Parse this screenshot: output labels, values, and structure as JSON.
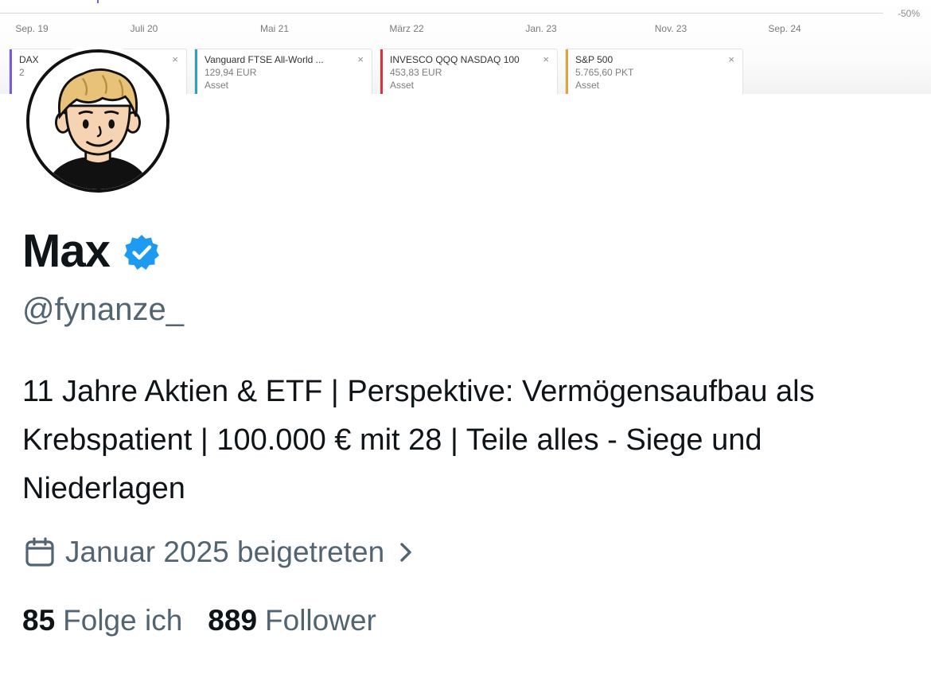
{
  "banner": {
    "pct_label": "-50%",
    "x_ticks": [
      "Sep. 19",
      "Juli 20",
      "Mai 21",
      "März 22",
      "Jan. 23",
      "Nov. 23",
      "Sep. 24"
    ],
    "assets": [
      {
        "name": "DAX",
        "value": "2",
        "type": "",
        "color": "#7b5cd6"
      },
      {
        "name": "Vanguard FTSE All-World ...",
        "value": "129,94 EUR",
        "type": "Asset",
        "color": "#2fa3b5"
      },
      {
        "name": "INVESCO QQQ NASDAQ 100",
        "value": "453,83 EUR",
        "type": "Asset",
        "color": "#d9333f"
      },
      {
        "name": "S&P 500",
        "value": "5.765,60 PKT",
        "type": "Asset",
        "color": "#e0a43a"
      }
    ],
    "close_glyph": "×"
  },
  "profile": {
    "name": "Max",
    "handle": "@fynanze_",
    "bio": "11 Jahre Aktien & ETF | Perspektive: Vermögensaufbau als Krebspatient | 100.000 € mit 28 | Teile alles - Siege und Niederlagen",
    "joined": "Januar 2025 beigetreten",
    "following_count": "85",
    "following_label": "Folge ich",
    "followers_count": "889",
    "followers_label": "Follower",
    "verified_color": "#1d9bf0",
    "icons": [
      "verified-badge-icon",
      "calendar-icon",
      "chevron-right-icon"
    ]
  }
}
